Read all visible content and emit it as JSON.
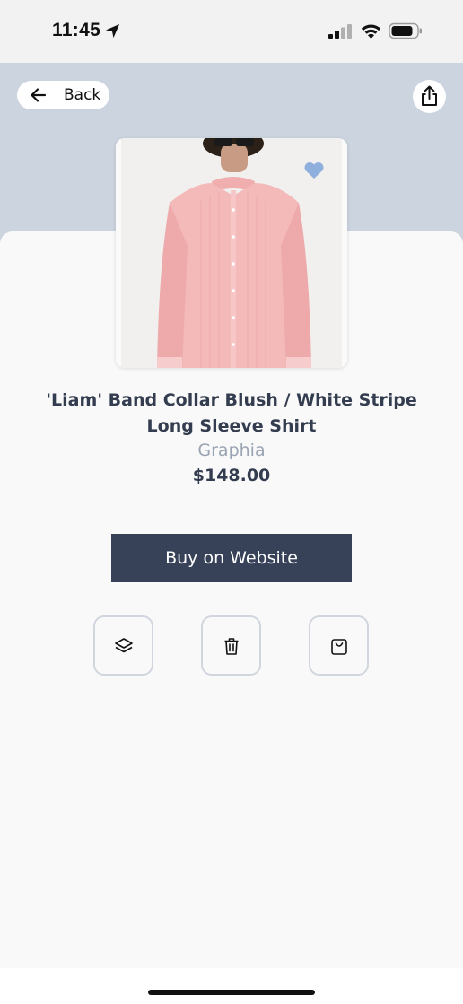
{
  "status_bar": {
    "time": "11:45",
    "icons": [
      "location-arrow-icon",
      "cellular-signal-icon",
      "wifi-icon",
      "battery-icon"
    ]
  },
  "header": {
    "back_label": "Back",
    "back_icon": "arrow-left-icon",
    "share_icon": "share-icon"
  },
  "product": {
    "title": "'Liam' Band Collar Blush / White Stripe Long Sleeve Shirt",
    "brand": "Graphia",
    "price": "$148.00",
    "favorite_icon": "heart-icon",
    "image_subject": "pink long sleeve band collar shirt on model"
  },
  "actions": {
    "buy_label": "Buy on Website",
    "buttons": [
      {
        "icon": "layers-icon"
      },
      {
        "icon": "trash-icon"
      },
      {
        "icon": "shopping-bag-icon"
      }
    ]
  },
  "colors": {
    "header_band": "#ccd4df",
    "sheet": "#f9f9f9",
    "buy_button": "#374258",
    "title_text": "#333d4f",
    "brand_text": "#9aa4b3",
    "heart": "#8fb0dd"
  }
}
